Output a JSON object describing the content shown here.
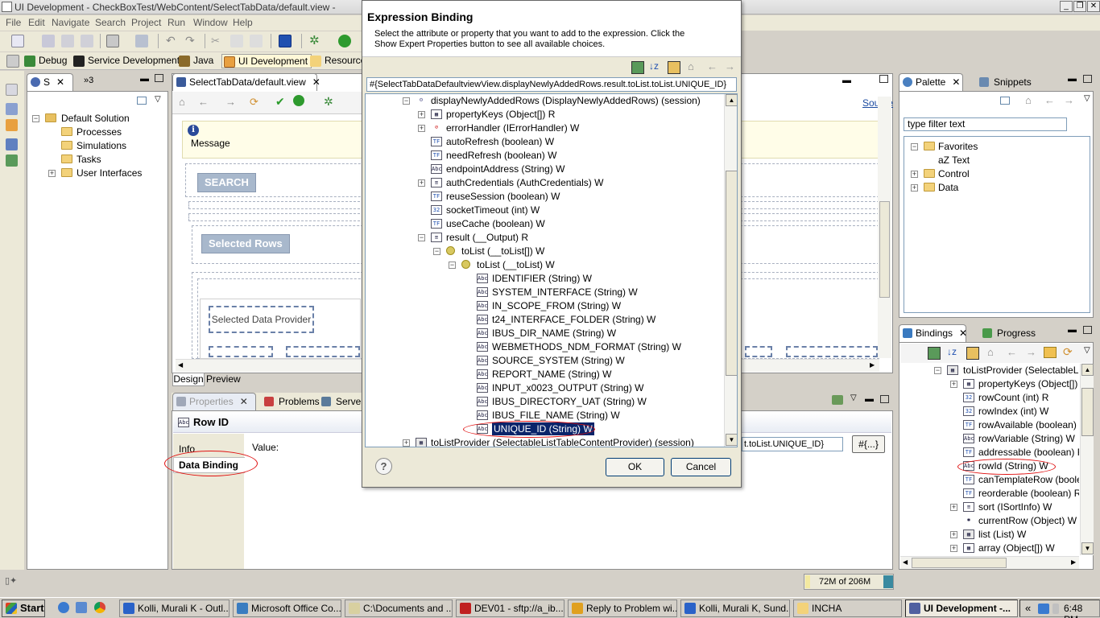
{
  "window": {
    "title": "UI Development - CheckBoxTest/WebContent/SelectTabData/default.view -",
    "controls": [
      "_",
      "❐",
      "✕"
    ]
  },
  "menubar": [
    "File",
    "Edit",
    "Navigate",
    "Search",
    "Project",
    "Run",
    "Window",
    "Help"
  ],
  "perspectives": [
    {
      "label": "Debug",
      "active": false
    },
    {
      "label": "Service Development",
      "active": false
    },
    {
      "label": "Java",
      "active": false
    },
    {
      "label": "UI Development",
      "active": true
    },
    {
      "label": "Resource",
      "active": false
    }
  ],
  "left_view": {
    "tab1": "S",
    "tab2": "»3",
    "tree": [
      {
        "label": "Default Solution",
        "level": 0,
        "expander": "-"
      },
      {
        "label": "Processes",
        "level": 1
      },
      {
        "label": "Simulations",
        "level": 1
      },
      {
        "label": "Tasks",
        "level": 1
      },
      {
        "label": "User Interfaces",
        "level": 1,
        "expander": "+"
      }
    ]
  },
  "editor": {
    "tab": "SelectTabData/default.view",
    "source_link": "Source",
    "message_label": "Message",
    "search_button": "SEARCH",
    "selected_rows_button": "Selected Rows",
    "data_provider_label": "Selected Data Provider",
    "bottom_tabs": [
      "Design",
      "Preview"
    ]
  },
  "bottom_view": {
    "tabs": [
      "Properties",
      "Problems",
      "Server"
    ],
    "heading": "Row ID",
    "side_tabs": [
      "Info",
      "Data Binding"
    ],
    "value_label": "Value:",
    "value_text": "t.toList.UNIQUE_ID}",
    "expr_button": "#{...}"
  },
  "dialog": {
    "title": "Expression Binding",
    "description": "Select the attribute or property that you want to add to the expression. Click the Show Expert Properties button to see all available choices.",
    "expression": "#{SelectTabDataDefaultviewView.displayNewlyAddedRows.result.toList.toList.UNIQUE_ID}",
    "tree": [
      {
        "label": "displayNewlyAddedRows (DisplayNewlyAddedRows) (session)",
        "level": 0,
        "expander": "-",
        "icon": "bean"
      },
      {
        "label": "propertyKeys (Object[]) R",
        "level": 1,
        "expander": "+",
        "icon": "array"
      },
      {
        "label": "errorHandler (IErrorHandler) W",
        "level": 1,
        "expander": "+",
        "icon": "handler"
      },
      {
        "label": "autoRefresh (boolean) W",
        "level": 1,
        "icon": "TF"
      },
      {
        "label": "needRefresh (boolean) W",
        "level": 1,
        "icon": "TF"
      },
      {
        "label": "endpointAddress (String) W",
        "level": 1,
        "icon": "Abc"
      },
      {
        "label": "authCredentials (AuthCredentials) W",
        "level": 1,
        "expander": "+",
        "icon": "doc"
      },
      {
        "label": "reuseSession (boolean) W",
        "level": 1,
        "icon": "TF"
      },
      {
        "label": "socketTimeout (int) W",
        "level": 1,
        "icon": "32"
      },
      {
        "label": "useCache (boolean) W",
        "level": 1,
        "icon": "TF"
      },
      {
        "label": "result (__Output) R",
        "level": 1,
        "expander": "-",
        "icon": "doc"
      },
      {
        "label": "toList (__toList[]) W",
        "level": 2,
        "expander": "-",
        "icon": "obj"
      },
      {
        "label": "toList (__toList) W",
        "level": 3,
        "expander": "-",
        "icon": "obj"
      },
      {
        "label": "IDENTIFIER (String) W",
        "level": 4,
        "icon": "Abc"
      },
      {
        "label": "SYSTEM_INTERFACE (String) W",
        "level": 4,
        "icon": "Abc"
      },
      {
        "label": "IN_SCOPE_FROM (String) W",
        "level": 4,
        "icon": "Abc"
      },
      {
        "label": "t24_INTERFACE_FOLDER (String) W",
        "level": 4,
        "icon": "Abc"
      },
      {
        "label": "IBUS_DIR_NAME (String) W",
        "level": 4,
        "icon": "Abc"
      },
      {
        "label": "WEBMETHODS_NDM_FORMAT (String) W",
        "level": 4,
        "icon": "Abc"
      },
      {
        "label": "SOURCE_SYSTEM (String) W",
        "level": 4,
        "icon": "Abc"
      },
      {
        "label": "REPORT_NAME (String) W",
        "level": 4,
        "icon": "Abc"
      },
      {
        "label": "INPUT_x0023_OUTPUT (String) W",
        "level": 4,
        "icon": "Abc"
      },
      {
        "label": "IBUS_DIRECTORY_UAT (String) W",
        "level": 4,
        "icon": "Abc"
      },
      {
        "label": "IBUS_FILE_NAME (String) W",
        "level": 4,
        "icon": "Abc"
      },
      {
        "label": "UNIQUE_ID (String) W",
        "level": 4,
        "icon": "Abc",
        "selected": true
      },
      {
        "label": "toListProvider (SelectableListTableContentProvider) (session)",
        "level": 0,
        "expander": "+",
        "icon": "table"
      }
    ],
    "ok_label": "OK",
    "cancel_label": "Cancel",
    "help_label": "?"
  },
  "palette": {
    "tabs": [
      "Palette",
      "Snippets"
    ],
    "filter_value": "type filter text",
    "tree": [
      {
        "label": "Favorites",
        "level": 0,
        "expander": "-",
        "icon": "folder"
      },
      {
        "label": "aZ Text",
        "level": 1
      },
      {
        "label": "Control",
        "level": 0,
        "expander": "+",
        "icon": "folder"
      },
      {
        "label": "Data",
        "level": 0,
        "expander": "+",
        "icon": "folder"
      }
    ]
  },
  "bindings": {
    "tabs": [
      "Bindings",
      "Progress"
    ],
    "tree": [
      {
        "label": "toListProvider (SelectableListTa",
        "level": 0,
        "expander": "-",
        "icon": "table"
      },
      {
        "label": "propertyKeys (Object[]) R",
        "level": 1,
        "expander": "+",
        "icon": "array"
      },
      {
        "label": "rowCount (int) R",
        "level": 1,
        "icon": "32"
      },
      {
        "label": "rowIndex (int) W",
        "level": 1,
        "icon": "32"
      },
      {
        "label": "rowAvailable (boolean) R",
        "level": 1,
        "icon": "TF"
      },
      {
        "label": "rowVariable (String) W",
        "level": 1,
        "icon": "Abc"
      },
      {
        "label": "addressable (boolean) R",
        "level": 1,
        "icon": "TF"
      },
      {
        "label": "rowId (String) W",
        "level": 1,
        "icon": "Abc"
      },
      {
        "label": "canTemplateRow (boolean",
        "level": 1,
        "icon": "TF"
      },
      {
        "label": "reorderable (boolean) R",
        "level": 1,
        "icon": "TF"
      },
      {
        "label": "sort (ISortInfo) W",
        "level": 1,
        "expander": "+",
        "icon": "doc"
      },
      {
        "label": "currentRow (Object) W",
        "level": 1,
        "icon": "star"
      },
      {
        "label": "list (List) W",
        "level": 1,
        "expander": "+",
        "icon": "table"
      },
      {
        "label": "array (Object[]) W",
        "level": 1,
        "expander": "+",
        "icon": "array"
      }
    ]
  },
  "status": {
    "memory": "72M of 206M"
  },
  "taskbar": {
    "start": "Start",
    "tasks": [
      {
        "label": "Kolli, Murali K - Outl...",
        "active": false,
        "color": "#2a62c8"
      },
      {
        "label": "Microsoft Office Co...",
        "active": false,
        "color": "#3a7cc0"
      },
      {
        "label": "C:\\Documents and ...",
        "active": false,
        "color": "#d8d0a0"
      },
      {
        "label": "DEV01 - sftp://a_ib...",
        "active": false,
        "color": "#c02020"
      },
      {
        "label": "Reply to Problem wi...",
        "active": false,
        "color": "#e0a020"
      },
      {
        "label": "Kolli, Murali K, Sund...",
        "active": false,
        "color": "#2a62c8"
      },
      {
        "label": "INCHA",
        "active": false,
        "color": "#f3d27a"
      },
      {
        "label": "UI Development -...",
        "active": true,
        "color": "#5060a0"
      }
    ],
    "clock": "6:48 PM",
    "tray_arrow": "«"
  }
}
